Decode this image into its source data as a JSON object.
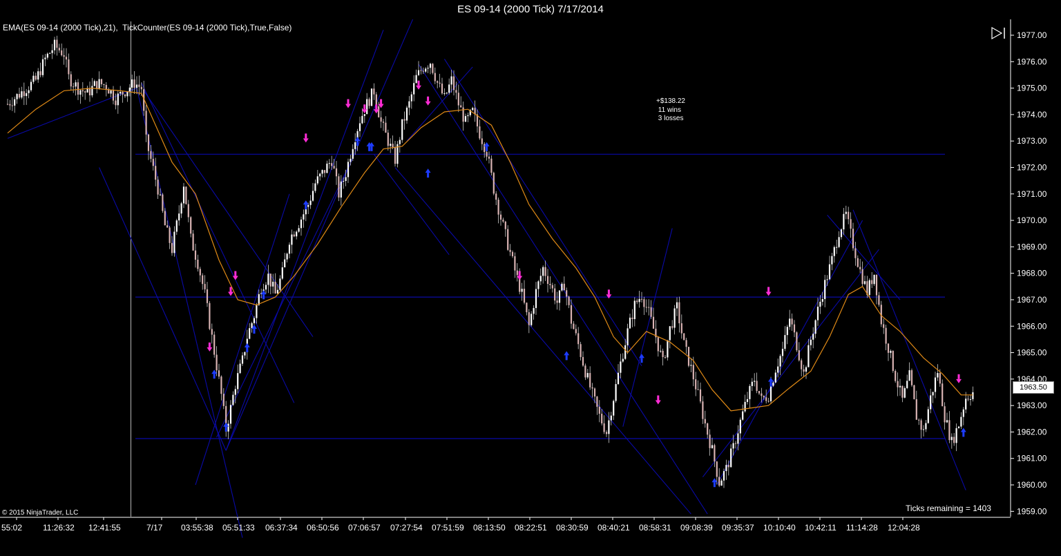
{
  "window": {
    "title": "ES 09-14 (2000 Tick)  7/17/2014"
  },
  "indicator_label": "EMA(ES 09-14 (2000 Tick),21),  TickCounter(ES 09-14 (2000 Tick),True,False)",
  "stats": {
    "pnl": "+$138.22",
    "wins": "11 wins",
    "losses": "3 losses"
  },
  "ticks_remaining": "Ticks remaining = 1403",
  "copyright": "© 2015 NinjaTrader, LLC",
  "last_price_label": "1963.50",
  "play_button": {
    "icon": "play-next-icon"
  },
  "colors": {
    "background": "#000000",
    "trendline": "#0a0aa8",
    "ema": "#e08a16",
    "up_arrow": "#1d3cff",
    "down_arrow": "#ff2cd6",
    "candle_up": "#ffffff",
    "candle_down": "#d9b3b3"
  },
  "chart_data": {
    "type": "candlestick",
    "symbol": "ES 09-14 (2000 Tick)",
    "date": "7/17/2014",
    "ylim": [
      1958.8,
      1977.6
    ],
    "y_ticks": [
      "1977.00",
      "1976.00",
      "1975.00",
      "1974.00",
      "1973.00",
      "1972.00",
      "1971.00",
      "1970.00",
      "1969.00",
      "1968.00",
      "1967.00",
      "1966.00",
      "1965.00",
      "1964.00",
      "1963.00",
      "1962.00",
      "1961.00",
      "1960.00",
      "1959.00"
    ],
    "x_ticks": [
      "55:02",
      "11:26:32",
      "12:41:55",
      "7/17",
      "03:55:38",
      "05:51:33",
      "06:37:34",
      "06:50:56",
      "07:06:57",
      "07:27:54",
      "07:51:59",
      "08:13:50",
      "08:22:51",
      "08:30:59",
      "08:40:21",
      "08:58:31",
      "09:08:39",
      "09:35:37",
      "10:10:40",
      "10:42:11",
      "11:14:28",
      "12:04:28"
    ],
    "session_break_index": 3,
    "horizontal_lines": [
      1972.5,
      1967.1,
      1961.75
    ],
    "close_path": [
      [
        0,
        1974.4
      ],
      [
        4,
        1974.7
      ],
      [
        8,
        1975.0
      ],
      [
        12,
        1975.3
      ],
      [
        16,
        1976.1
      ],
      [
        20,
        1976.6
      ],
      [
        24,
        1976.3
      ],
      [
        26,
        1975.4
      ],
      [
        30,
        1975.0
      ],
      [
        34,
        1974.8
      ],
      [
        38,
        1975.2
      ],
      [
        42,
        1975.1
      ],
      [
        46,
        1974.6
      ],
      [
        50,
        1974.9
      ],
      [
        54,
        1975.2
      ],
      [
        57,
        1975.0
      ],
      [
        59,
        1973.0
      ],
      [
        61,
        1972.3
      ],
      [
        64,
        1971.2
      ],
      [
        67,
        1969.8
      ],
      [
        70,
        1968.9
      ],
      [
        73,
        1970.3
      ],
      [
        75,
        1971.4
      ],
      [
        78,
        1969.3
      ],
      [
        81,
        1968.4
      ],
      [
        84,
        1967.2
      ],
      [
        86,
        1966.1
      ],
      [
        89,
        1964.5
      ],
      [
        91,
        1963.4
      ],
      [
        93,
        1962.1
      ],
      [
        95,
        1962.9
      ],
      [
        97,
        1963.8
      ],
      [
        100,
        1964.7
      ],
      [
        102,
        1965.6
      ],
      [
        105,
        1966.4
      ],
      [
        108,
        1967.5
      ],
      [
        111,
        1967.9
      ],
      [
        114,
        1967.2
      ],
      [
        117,
        1968.0
      ],
      [
        120,
        1969.3
      ],
      [
        124,
        1969.9
      ],
      [
        128,
        1970.6
      ],
      [
        131,
        1971.4
      ],
      [
        135,
        1971.9
      ],
      [
        138,
        1972.3
      ],
      [
        141,
        1971.0
      ],
      [
        144,
        1971.8
      ],
      [
        147,
        1972.9
      ],
      [
        150,
        1973.8
      ],
      [
        153,
        1974.4
      ],
      [
        156,
        1974.9
      ],
      [
        159,
        1973.7
      ],
      [
        162,
        1973.0
      ],
      [
        165,
        1972.3
      ],
      [
        168,
        1973.6
      ],
      [
        171,
        1974.4
      ],
      [
        174,
        1975.4
      ],
      [
        177,
        1975.8
      ],
      [
        180,
        1976.0
      ],
      [
        183,
        1975.2
      ],
      [
        186,
        1974.6
      ],
      [
        189,
        1975.3
      ],
      [
        192,
        1974.4
      ],
      [
        195,
        1973.7
      ],
      [
        198,
        1974.1
      ],
      [
        201,
        1973.3
      ],
      [
        204,
        1972.6
      ],
      [
        207,
        1971.2
      ],
      [
        210,
        1970.1
      ],
      [
        213,
        1969.1
      ],
      [
        216,
        1968.1
      ],
      [
        219,
        1967.2
      ],
      [
        222,
        1966.0
      ],
      [
        225,
        1967.3
      ],
      [
        228,
        1968.2
      ],
      [
        231,
        1967.6
      ],
      [
        234,
        1966.9
      ],
      [
        237,
        1967.6
      ],
      [
        240,
        1966.2
      ],
      [
        243,
        1965.3
      ],
      [
        246,
        1964.3
      ],
      [
        249,
        1963.4
      ],
      [
        252,
        1962.6
      ],
      [
        255,
        1962.0
      ],
      [
        258,
        1963.3
      ],
      [
        261,
        1964.6
      ],
      [
        264,
        1965.8
      ],
      [
        267,
        1966.8
      ],
      [
        270,
        1967.2
      ],
      [
        273,
        1966.5
      ],
      [
        276,
        1965.6
      ],
      [
        279,
        1964.6
      ],
      [
        282,
        1965.9
      ],
      [
        285,
        1966.7
      ],
      [
        288,
        1965.3
      ],
      [
        291,
        1964.4
      ],
      [
        294,
        1963.4
      ],
      [
        297,
        1962.3
      ],
      [
        300,
        1961.3
      ],
      [
        303,
        1960.1
      ],
      [
        306,
        1960.6
      ],
      [
        309,
        1961.4
      ],
      [
        312,
        1962.4
      ],
      [
        315,
        1963.3
      ],
      [
        318,
        1964.0
      ],
      [
        321,
        1963.2
      ],
      [
        324,
        1963.4
      ],
      [
        327,
        1964.4
      ],
      [
        330,
        1965.1
      ],
      [
        333,
        1966.3
      ],
      [
        336,
        1965.3
      ],
      [
        339,
        1964.2
      ],
      [
        342,
        1965.5
      ],
      [
        345,
        1966.6
      ],
      [
        348,
        1967.6
      ],
      [
        351,
        1968.5
      ],
      [
        354,
        1969.6
      ],
      [
        357,
        1970.2
      ],
      [
        360,
        1969.1
      ],
      [
        363,
        1968.1
      ],
      [
        366,
        1967.3
      ],
      [
        369,
        1968.0
      ],
      [
        372,
        1966.2
      ],
      [
        375,
        1965.2
      ],
      [
        378,
        1964.1
      ],
      [
        381,
        1963.2
      ],
      [
        384,
        1964.1
      ],
      [
        387,
        1962.6
      ],
      [
        390,
        1962.0
      ],
      [
        393,
        1963.3
      ],
      [
        396,
        1964.3
      ],
      [
        399,
        1962.6
      ],
      [
        402,
        1961.6
      ],
      [
        405,
        1962.3
      ],
      [
        408,
        1963.3
      ],
      [
        411,
        1963.5
      ]
    ],
    "trendlines": [
      [
        [
          0,
          1973.1
        ],
        [
          55,
          1975.0
        ]
      ],
      [
        [
          55,
          1975.0
        ],
        [
          100,
          1958.0
        ]
      ],
      [
        [
          39,
          1972.0
        ],
        [
          93,
          1961.3
        ]
      ],
      [
        [
          93,
          1961.3
        ],
        [
          173,
          1977.7
        ]
      ],
      [
        [
          93,
          1961.3
        ],
        [
          160,
          1977.2
        ]
      ],
      [
        [
          89,
          1961.8
        ],
        [
          145,
          1972.0
        ]
      ],
      [
        [
          58,
          1974.9
        ],
        [
          130,
          1965.6
        ]
      ],
      [
        [
          57,
          1975.2
        ],
        [
          122,
          1963.1
        ]
      ],
      [
        [
          80,
          1960.0
        ],
        [
          120,
          1971.0
        ]
      ],
      [
        [
          170,
          1973.0
        ],
        [
          198,
          1975.8
        ]
      ],
      [
        [
          175,
          1975.9
        ],
        [
          298,
          1958.9
        ]
      ],
      [
        [
          165,
          1972.0
        ],
        [
          291,
          1958.9
        ]
      ],
      [
        [
          186,
          1976.1
        ],
        [
          270,
          1964.5
        ]
      ],
      [
        [
          156,
          1972.5
        ],
        [
          188,
          1968.7
        ]
      ],
      [
        [
          262,
          1962.2
        ],
        [
          283,
          1969.7
        ]
      ],
      [
        [
          302,
          1960.0
        ],
        [
          364,
          1970.0
        ]
      ],
      [
        [
          296,
          1960.3
        ],
        [
          371,
          1968.9
        ]
      ],
      [
        [
          349,
          1970.2
        ],
        [
          380,
          1967.0
        ]
      ],
      [
        [
          360,
          1970.4
        ],
        [
          408,
          1959.8
        ]
      ]
    ],
    "ema_path": [
      [
        0,
        1973.3
      ],
      [
        12,
        1974.2
      ],
      [
        24,
        1974.9
      ],
      [
        36,
        1975.0
      ],
      [
        48,
        1974.9
      ],
      [
        57,
        1974.8
      ],
      [
        63,
        1973.6
      ],
      [
        70,
        1972.2
      ],
      [
        80,
        1971.0
      ],
      [
        90,
        1968.5
      ],
      [
        98,
        1967.0
      ],
      [
        106,
        1966.8
      ],
      [
        114,
        1967.1
      ],
      [
        122,
        1967.9
      ],
      [
        132,
        1969.1
      ],
      [
        142,
        1970.5
      ],
      [
        152,
        1971.8
      ],
      [
        160,
        1972.7
      ],
      [
        168,
        1972.8
      ],
      [
        176,
        1973.5
      ],
      [
        186,
        1974.1
      ],
      [
        196,
        1974.2
      ],
      [
        206,
        1973.6
      ],
      [
        214,
        1972.2
      ],
      [
        222,
        1970.6
      ],
      [
        232,
        1969.3
      ],
      [
        242,
        1968.2
      ],
      [
        250,
        1967.1
      ],
      [
        258,
        1965.6
      ],
      [
        264,
        1965.0
      ],
      [
        272,
        1965.8
      ],
      [
        282,
        1965.4
      ],
      [
        292,
        1964.7
      ],
      [
        300,
        1963.6
      ],
      [
        308,
        1962.8
      ],
      [
        316,
        1962.9
      ],
      [
        324,
        1963.0
      ],
      [
        332,
        1963.6
      ],
      [
        342,
        1964.3
      ],
      [
        350,
        1965.6
      ],
      [
        358,
        1967.2
      ],
      [
        364,
        1967.5
      ],
      [
        372,
        1966.4
      ],
      [
        380,
        1965.8
      ],
      [
        390,
        1964.8
      ],
      [
        398,
        1964.2
      ],
      [
        406,
        1963.4
      ],
      [
        411,
        1963.4
      ]
    ],
    "buy_signals": [
      [
        88,
        1964.2
      ],
      [
        93,
        1962.2
      ],
      [
        102,
        1965.2
      ],
      [
        105,
        1965.9
      ],
      [
        109,
        1967.2
      ],
      [
        127,
        1970.6
      ],
      [
        149,
        1973.0
      ],
      [
        154,
        1972.8
      ],
      [
        155,
        1972.8
      ],
      [
        179,
        1971.8
      ],
      [
        204,
        1972.8
      ],
      [
        238,
        1964.9
      ],
      [
        270,
        1964.8
      ],
      [
        301,
        1960.1
      ],
      [
        325,
        1963.9
      ],
      [
        407,
        1962.0
      ]
    ],
    "sell_signals": [
      [
        86,
        1965.2
      ],
      [
        95,
        1967.3
      ],
      [
        97,
        1967.9
      ],
      [
        127,
        1973.1
      ],
      [
        145,
        1974.4
      ],
      [
        152,
        1974.2
      ],
      [
        157,
        1974.2
      ],
      [
        159,
        1974.4
      ],
      [
        175,
        1975.1
      ],
      [
        179,
        1974.5
      ],
      [
        218,
        1967.9
      ],
      [
        256,
        1967.2
      ],
      [
        277,
        1963.2
      ],
      [
        324,
        1967.3
      ],
      [
        405,
        1964.0
      ]
    ]
  }
}
